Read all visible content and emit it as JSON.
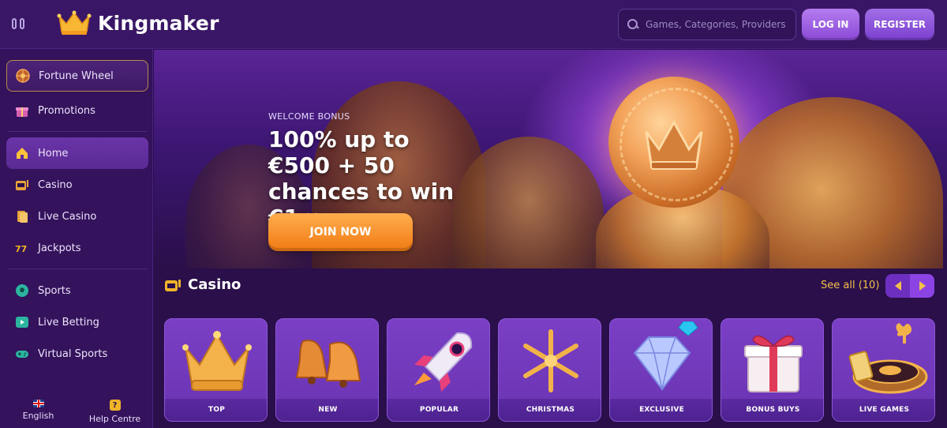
{
  "header": {
    "logo_text": "Kingmaker",
    "search_placeholder": "Games, Categories, Providers",
    "login_label": "LOG IN",
    "register_label": "REGISTER"
  },
  "sidebar": {
    "items": [
      {
        "label": "Fortune Wheel",
        "icon": "fortune-wheel-icon"
      },
      {
        "label": "Promotions",
        "icon": "gift-icon"
      },
      {
        "label": "Home",
        "icon": "home-icon",
        "active": true
      },
      {
        "label": "Casino",
        "icon": "slot-machine-icon"
      },
      {
        "label": "Live Casino",
        "icon": "cards-icon"
      },
      {
        "label": "Jackpots",
        "icon": "777-icon"
      },
      {
        "label": "Sports",
        "icon": "football-icon"
      },
      {
        "label": "Live Betting",
        "icon": "live-play-icon"
      },
      {
        "label": "Virtual Sports",
        "icon": "gamepad-icon"
      }
    ],
    "footer": {
      "language": "English",
      "help": "Help Centre"
    }
  },
  "hero": {
    "eyebrow": "WELCOME BONUS",
    "headline": "100% up to €500 + 50 chances to win €1m",
    "cta": "JOIN NOW"
  },
  "casino": {
    "title": "Casino",
    "see_all": "See all (10)",
    "categories": [
      {
        "label": "TOP",
        "icon": "crown-icon"
      },
      {
        "label": "NEW",
        "icon": "bells-icon"
      },
      {
        "label": "POPULAR",
        "icon": "rocket-icon"
      },
      {
        "label": "CHRISTMAS",
        "icon": "snowflake-icon"
      },
      {
        "label": "EXCLUSIVE",
        "icon": "diamond-icon"
      },
      {
        "label": "BONUS BUYS",
        "icon": "gift-box-icon"
      },
      {
        "label": "LIVE GAMES",
        "icon": "roulette-icon"
      }
    ]
  },
  "colors": {
    "background": "#2a0f4a",
    "accent_gold": "#f3c14a",
    "cta_orange": "#f58a1f",
    "button_purple": "#9a5ce6"
  }
}
